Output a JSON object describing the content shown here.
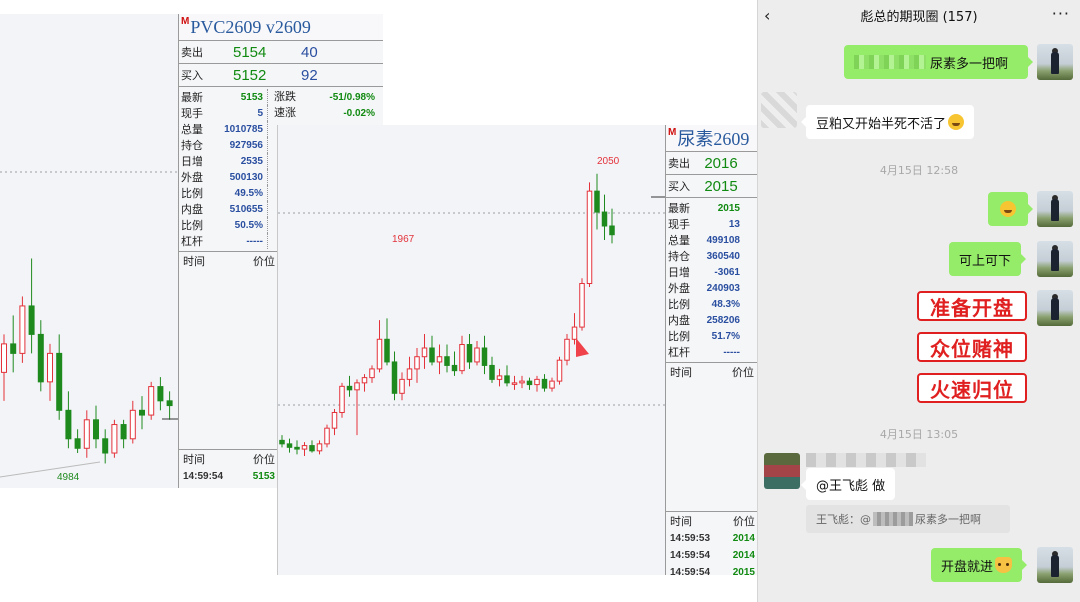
{
  "pvc": {
    "mark": "M",
    "title": "PVC2609  v2609",
    "sell_label": "卖出",
    "sell_price": "5154",
    "sell_vol": "40",
    "buy_label": "买入",
    "buy_price": "5152",
    "buy_vol": "92",
    "stats": [
      {
        "l1": "最新",
        "v1": "5153",
        "l2": "涨跌",
        "v2": "-51/0.98%"
      },
      {
        "l1": "现手",
        "v1": "5",
        "l2": "速涨",
        "v2": "-0.02%"
      },
      {
        "l1": "总量",
        "v1": "1010785",
        "l2": "",
        "v2": ""
      },
      {
        "l1": "持仓",
        "v1": "927956",
        "l2": "",
        "v2": ""
      },
      {
        "l1": "日增",
        "v1": "2535",
        "l2": "",
        "v2": ""
      },
      {
        "l1": "外盘",
        "v1": "500130",
        "l2": "",
        "v2": ""
      },
      {
        "l1": "比例",
        "v1": "49.5%",
        "l2": "",
        "v2": ""
      },
      {
        "l1": "内盘",
        "v1": "510655",
        "l2": "",
        "v2": ""
      },
      {
        "l1": "比例",
        "v1": "50.5%",
        "l2": "",
        "v2": ""
      },
      {
        "l1": "杠杆",
        "v1": "-----",
        "l2": "",
        "v2": ""
      }
    ],
    "col_time": "时间",
    "col_price": "价位",
    "trade_time": "14:59:54",
    "trade_price": "5153",
    "low_label": "4984",
    "candles": [
      [
        5080,
        5120,
        5050,
        5110
      ],
      [
        5110,
        5140,
        5080,
        5100
      ],
      [
        5100,
        5160,
        5090,
        5150
      ],
      [
        5150,
        5200,
        5100,
        5120
      ],
      [
        5120,
        5135,
        5060,
        5070
      ],
      [
        5070,
        5110,
        5050,
        5100
      ],
      [
        5100,
        5120,
        5030,
        5040
      ],
      [
        5040,
        5060,
        5000,
        5010
      ],
      [
        5010,
        5020,
        4995,
        5000
      ],
      [
        5000,
        5040,
        4990,
        5030
      ],
      [
        5030,
        5045,
        5000,
        5010
      ],
      [
        5010,
        5020,
        4984,
        4995
      ],
      [
        4995,
        5030,
        4990,
        5025
      ],
      [
        5025,
        5030,
        5000,
        5010
      ],
      [
        5010,
        5050,
        5005,
        5040
      ],
      [
        5040,
        5055,
        5020,
        5035
      ],
      [
        5035,
        5070,
        5030,
        5065
      ],
      [
        5065,
        5075,
        5040,
        5050
      ],
      [
        5050,
        5060,
        5030,
        5045
      ]
    ]
  },
  "urea": {
    "mark": "M",
    "title": "尿素2609",
    "sell_label": "卖出",
    "sell_price": "2016",
    "buy_label": "买入",
    "buy_price": "2015",
    "stats": [
      {
        "l1": "最新",
        "v1": "2015"
      },
      {
        "l1": "现手",
        "v1": "13"
      },
      {
        "l1": "总量",
        "v1": "499108"
      },
      {
        "l1": "持仓",
        "v1": "360540"
      },
      {
        "l1": "日增",
        "v1": "-3061"
      },
      {
        "l1": "外盘",
        "v1": "240903"
      },
      {
        "l1": "比例",
        "v1": "48.3%"
      },
      {
        "l1": "内盘",
        "v1": "258206"
      },
      {
        "l1": "比例",
        "v1": "51.7%"
      },
      {
        "l1": "杠杆",
        "v1": "-----"
      }
    ],
    "col_time": "时间",
    "col_price": "价位",
    "trades": [
      {
        "time": "14:59:53",
        "price": "2014"
      },
      {
        "time": "14:59:54",
        "price": "2014"
      },
      {
        "time": "14:59:54",
        "price": "2015"
      }
    ],
    "high_label": "2050",
    "mid_high_label": "1967",
    "candles": [
      [
        1897,
        1900,
        1893,
        1895
      ],
      [
        1895,
        1898,
        1890,
        1893
      ],
      [
        1893,
        1897,
        1889,
        1892
      ],
      [
        1892,
        1896,
        1888,
        1894
      ],
      [
        1894,
        1897,
        1890,
        1891
      ],
      [
        1891,
        1897,
        1889,
        1895
      ],
      [
        1895,
        1906,
        1893,
        1904
      ],
      [
        1904,
        1915,
        1900,
        1913
      ],
      [
        1913,
        1930,
        1910,
        1928
      ],
      [
        1928,
        1934,
        1922,
        1926
      ],
      [
        1926,
        1932,
        1900,
        1930
      ],
      [
        1930,
        1935,
        1925,
        1933
      ],
      [
        1933,
        1940,
        1930,
        1938
      ],
      [
        1938,
        1966,
        1936,
        1955
      ],
      [
        1955,
        1967,
        1940,
        1942
      ],
      [
        1942,
        1948,
        1920,
        1924
      ],
      [
        1924,
        1936,
        1920,
        1932
      ],
      [
        1932,
        1945,
        1928,
        1938
      ],
      [
        1938,
        1950,
        1930,
        1945
      ],
      [
        1945,
        1958,
        1938,
        1950
      ],
      [
        1950,
        1957,
        1940,
        1942
      ],
      [
        1942,
        1952,
        1935,
        1945
      ],
      [
        1945,
        1952,
        1936,
        1940
      ],
      [
        1940,
        1948,
        1934,
        1937
      ],
      [
        1937,
        1957,
        1935,
        1952
      ],
      [
        1952,
        1958,
        1938,
        1942
      ],
      [
        1942,
        1954,
        1940,
        1950
      ],
      [
        1950,
        1957,
        1935,
        1940
      ],
      [
        1940,
        1945,
        1930,
        1932
      ],
      [
        1932,
        1938,
        1928,
        1934
      ],
      [
        1934,
        1940,
        1928,
        1930
      ],
      [
        1930,
        1934,
        1926,
        1930
      ],
      [
        1930,
        1934,
        1927,
        1931
      ],
      [
        1931,
        1933,
        1926,
        1929
      ],
      [
        1929,
        1934,
        1925,
        1932
      ],
      [
        1932,
        1935,
        1925,
        1927
      ],
      [
        1927,
        1933,
        1925,
        1931
      ],
      [
        1931,
        1945,
        1929,
        1943
      ],
      [
        1943,
        1958,
        1940,
        1955
      ],
      [
        1955,
        1970,
        1952,
        1962
      ],
      [
        1962,
        1990,
        1960,
        1987
      ],
      [
        1987,
        2045,
        1985,
        2040
      ],
      [
        2040,
        2050,
        2018,
        2028
      ],
      [
        2028,
        2038,
        2012,
        2020
      ],
      [
        2020,
        2030,
        2010,
        2015
      ]
    ]
  },
  "chat": {
    "title": "彪总的期现圈 (157)",
    "back_icon": "‹",
    "more_icon": "···",
    "msg1": "尿素多一把啊",
    "msg2": "豆粕又开始半死不活了",
    "time1": "4月15日 12:58",
    "msg4": "可上可下",
    "big1": "准备开盘",
    "big2": "众位赌神",
    "big3": "火速归位",
    "time2": "4月15日 13:05",
    "msg5": "@王飞彪 做",
    "quote_prefix": "王飞彪：@",
    "quote_suffix": "尿素多一把啊",
    "msg6": "开盘就进"
  }
}
